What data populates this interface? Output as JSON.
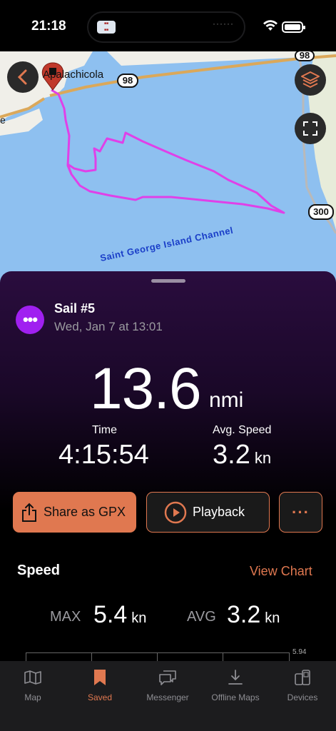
{
  "status_bar": {
    "time": "21:18",
    "dynamic_island_dots": "······"
  },
  "map": {
    "town_label": "Apalachicola",
    "town_label_partial": "e",
    "highway_98_main": "98",
    "highway_98_top": "98",
    "highway_300": "300",
    "channel_label": "Saint George Island Channel",
    "track_color": "#e040e8",
    "pin_color": "#c0392b"
  },
  "activity": {
    "title": "Sail #5",
    "date": "Wed, Jan 7 at 13:01",
    "distance": "13.6",
    "distance_unit": "nmi",
    "time_label": "Time",
    "time_value": "4:15:54",
    "avg_speed_label": "Avg. Speed",
    "avg_speed_value": "3.2",
    "avg_speed_unit": "kn",
    "icon": "ellipsis-icon",
    "icon_color": "#a020f0"
  },
  "actions": {
    "share_label": "Share as GPX",
    "playback_label": "Playback",
    "more_label": "···",
    "accent": "#e07850"
  },
  "speed": {
    "section_title": "Speed",
    "view_chart": "View Chart",
    "max_label": "MAX",
    "max_value": "5.4",
    "max_unit": "kn",
    "avg_label": "AVG",
    "avg_value": "3.2",
    "avg_unit": "kn",
    "chart_top_tick": "5.94"
  },
  "tabbar": {
    "items": [
      {
        "label": "Map",
        "icon": "map-icon"
      },
      {
        "label": "Saved",
        "icon": "bookmark-icon",
        "active": true
      },
      {
        "label": "Messenger",
        "icon": "chat-bubbles-icon"
      },
      {
        "label": "Offline Maps",
        "icon": "download-icon"
      },
      {
        "label": "Devices",
        "icon": "devices-icon"
      }
    ]
  }
}
